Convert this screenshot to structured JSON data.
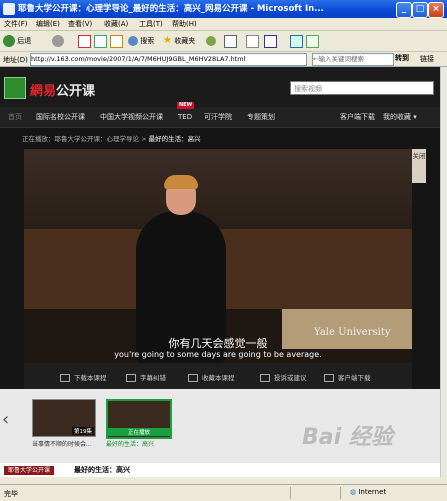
{
  "window": {
    "title": "耶鲁大学公开课：心理学导论_最好的生活：高兴_网易公开课 - Microsoft In...",
    "controls": [
      "_",
      "□",
      "×"
    ]
  },
  "menu": [
    "文件(F)",
    "编辑(E)",
    "查看(V)",
    "收藏(A)",
    "工具(T)",
    "帮助(H)"
  ],
  "toolbar": {
    "back": "后退",
    "search": "搜索",
    "favorites": "收藏夹"
  },
  "address": {
    "label": "地址(D)",
    "url": "http://v.163.com/movie/2007/1/A/7/M6HUJ9GBL_M6HV28LA7.html",
    "search_placeholder": "←输入关键词搜索",
    "go": "转到",
    "links": "链接"
  },
  "site": {
    "brand_red": "網易",
    "brand_white": "公开课",
    "search_placeholder": "搜索视频",
    "nav": [
      "首页",
      "国际名校公开课",
      "中国大学视频公开课",
      "TED",
      "可汗学院",
      "专题策划"
    ],
    "nav_right": [
      "客户端下载",
      "我的收藏 ▾"
    ],
    "new_badge": "NEW",
    "breadcrumb": {
      "now": "正在播放：",
      "path": "耶鲁大学公开课：心理学导论 > ",
      "current": "最好的生活：高兴"
    }
  },
  "video": {
    "watermark": "Yale University",
    "subtitle_cn": "你有几天会感觉一般",
    "subtitle_en": "you're going to some days are going to be average.",
    "side_tab": "关闭"
  },
  "actions": [
    "下载本课程",
    "字幕纠错",
    "收藏本课程",
    "投诉或建议",
    "客户端下载"
  ],
  "related": [
    {
      "badge": "第19集",
      "caption": "当事情不顺的时候会..."
    },
    {
      "badge": "正在播放",
      "caption": "最好的生活：高兴"
    }
  ],
  "bottom": {
    "tag": "耶鲁大学公开课",
    "title": "最好的生活：高兴"
  },
  "status": {
    "text": "完毕",
    "zone": "Internet"
  },
  "watermark_site": "Bai 经验"
}
